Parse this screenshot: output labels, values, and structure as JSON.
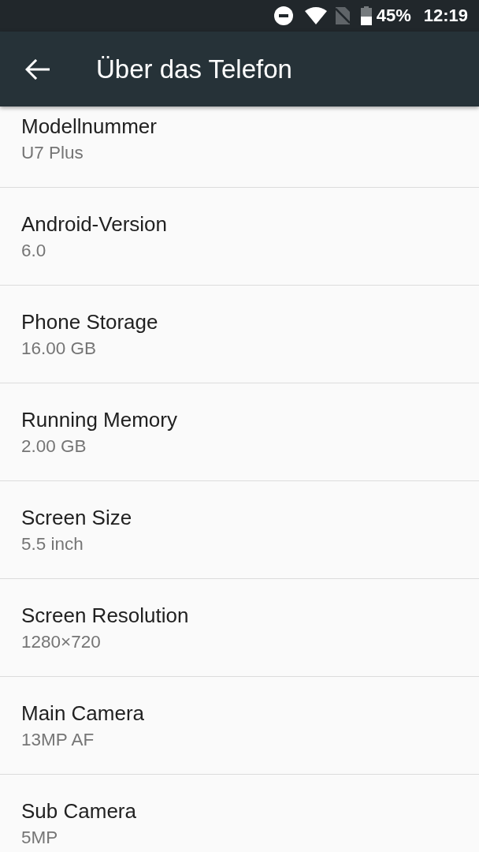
{
  "status_bar": {
    "battery_percent": "45%",
    "time": "12:19"
  },
  "app_bar": {
    "title": "Über das Telefon"
  },
  "items": [
    {
      "title": "Modellnummer",
      "summary": "U7 Plus"
    },
    {
      "title": "Android-Version",
      "summary": "6.0"
    },
    {
      "title": "Phone Storage",
      "summary": "16.00 GB"
    },
    {
      "title": "Running Memory",
      "summary": "2.00 GB"
    },
    {
      "title": "Screen Size",
      "summary": "5.5 inch"
    },
    {
      "title": "Screen Resolution",
      "summary": "1280×720"
    },
    {
      "title": "Main Camera",
      "summary": "13MP AF"
    },
    {
      "title": "Sub Camera",
      "summary": "5MP"
    }
  ]
}
